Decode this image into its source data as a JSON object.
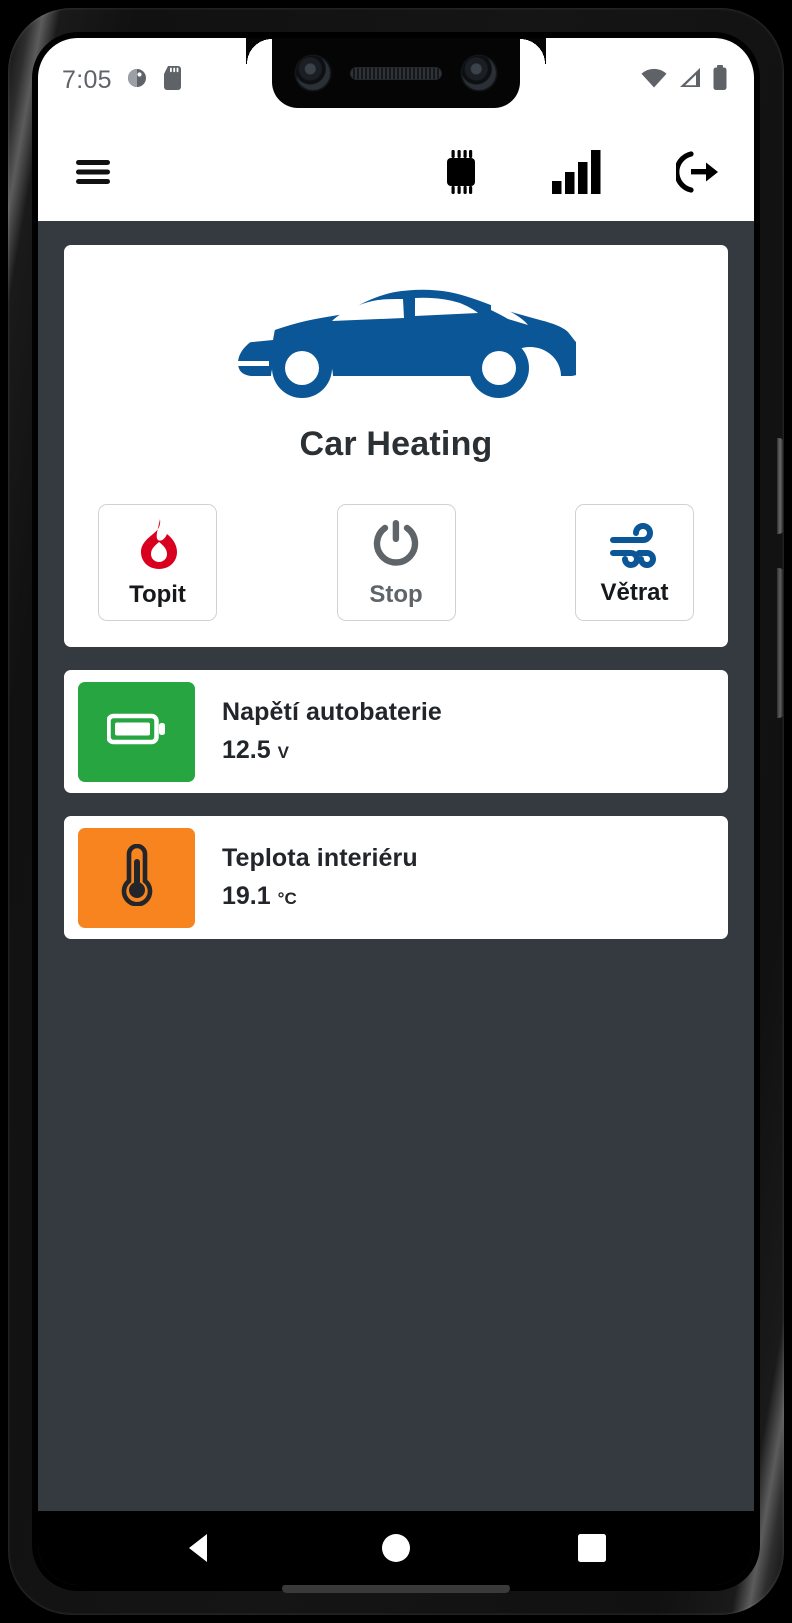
{
  "status_bar": {
    "time": "7:05",
    "icons": [
      "do-not-disturb-icon",
      "sd-card-icon",
      "wifi-icon",
      "cellular-signal-icon",
      "battery-icon"
    ]
  },
  "toolbar": {
    "menu_icon": "hamburger-menu-icon",
    "chip_icon": "microchip-icon",
    "signal_icon": "signal-bars-icon",
    "logout_icon": "logout-icon"
  },
  "car_card": {
    "illustration": "blue-car-side-view",
    "title": "Car Heating",
    "buttons": [
      {
        "label": "Topit",
        "icon": "flame-icon",
        "state": "enabled",
        "color": "#d8001e"
      },
      {
        "label": "Stop",
        "icon": "power-icon",
        "state": "disabled",
        "color": "#5e6468"
      },
      {
        "label": "Větrat",
        "icon": "wind-icon",
        "state": "enabled",
        "color": "#0b5697"
      }
    ]
  },
  "sensors": [
    {
      "label": "Napětí autobaterie",
      "value": "12.5",
      "unit": "V",
      "icon": "battery-icon",
      "tile_color": "#26a541"
    },
    {
      "label": "Teplota interiéru",
      "value": "19.1",
      "unit": "°C",
      "icon": "thermometer-icon",
      "tile_color": "#f7841f"
    }
  ],
  "nav_bar": {
    "back": "back-triangle-icon",
    "home": "home-circle-icon",
    "recents": "recents-square-icon"
  },
  "theme": {
    "background": "#343a40",
    "card": "#ffffff",
    "accent_blue": "#0b5697"
  }
}
